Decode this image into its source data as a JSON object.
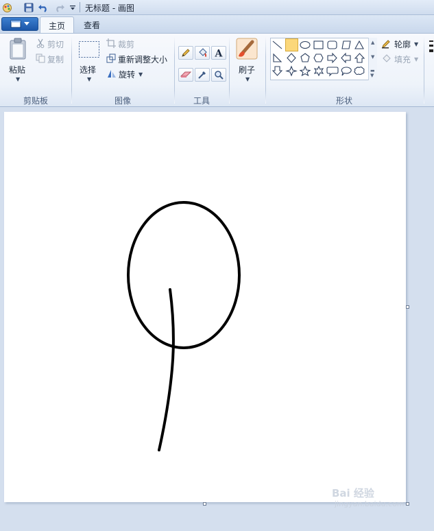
{
  "window": {
    "title": "无标题 - 画图"
  },
  "tabs": [
    {
      "label": "主页"
    },
    {
      "label": "查看"
    }
  ],
  "clipboard": {
    "paste": "粘贴",
    "cut": "剪切",
    "copy": "复制",
    "group": "剪贴板"
  },
  "image": {
    "select": "选择",
    "crop": "裁剪",
    "resize": "重新调整大小",
    "rotate": "旋转",
    "group": "图像"
  },
  "tools": {
    "group": "工具"
  },
  "brushes": {
    "label": "刷子"
  },
  "shapes": {
    "outline": "轮廓",
    "fill": "填充",
    "group": "形状"
  },
  "watermark": {
    "text": "Bai 经验",
    "sub": "jingyan.baidu.com"
  },
  "colors": {
    "accent": "#1c56a8",
    "selected_shape": "#fbd77a",
    "canvas": "#ffffff",
    "workspace": "#d4dfee"
  }
}
